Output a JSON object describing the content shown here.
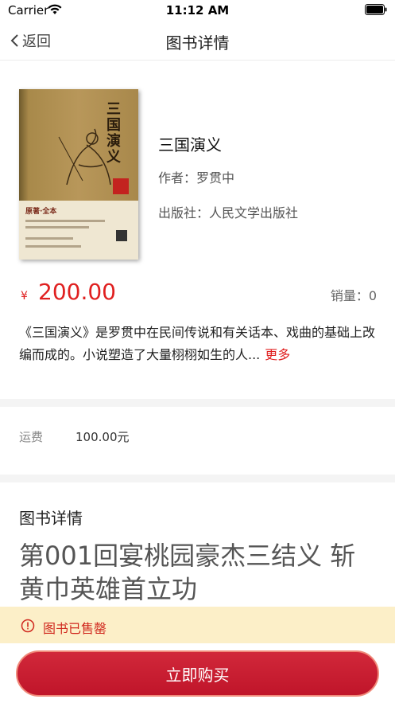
{
  "status_bar": {
    "carrier": "Carrier",
    "time": "11:12 AM"
  },
  "nav": {
    "back_label": "返回",
    "title": "图书详情"
  },
  "book": {
    "cover_text": "三国演义",
    "cover_band_text": "原著·全本",
    "title": "三国演义",
    "author": "作者：罗贯中",
    "publisher": "出版社：人民文学出版社"
  },
  "price": {
    "symbol": "¥",
    "value": "200.00",
    "sales": "销量：0"
  },
  "description": {
    "text": "《三国演义》是罗贯中在民间传说和有关话本、戏曲的基础上改编而成的。小说塑造了大量栩栩如生的人...",
    "more_label": "更多"
  },
  "shipping": {
    "label": "运费",
    "value": "100.00元"
  },
  "detail": {
    "heading": "图书详情",
    "chapter_title": "第001回宴桃园豪杰三结义 斩黄巾英雄首立功"
  },
  "soldout": {
    "text": "图书已售罄"
  },
  "buy_button": {
    "label": "立即购买"
  },
  "colors": {
    "accent": "#e02020",
    "button": "#c0152a",
    "banner": "#fcefc8"
  }
}
